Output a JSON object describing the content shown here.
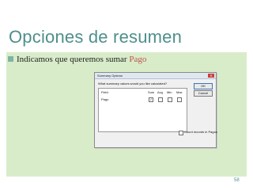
{
  "slide": {
    "title": "Opciones de resumen",
    "bullet_text": "Indicamos que queremos sumar ",
    "bullet_highlight": "Pago",
    "page_number": "58"
  },
  "dialog": {
    "title": "Summary Options",
    "close_glyph": "✕",
    "question": "What summary values would you like calculated?",
    "columns": {
      "field": "Field",
      "sum": "Sum",
      "avg": "Avg",
      "min": "Min",
      "max": "Max"
    },
    "rows": [
      {
        "name": "Pago",
        "sum_check": "✓",
        "avg_check": "",
        "min_check": "",
        "max_check": ""
      }
    ],
    "ok_label": "OK",
    "cancel_label": "Cancel",
    "count_label": "Count records in Pagos"
  },
  "colors": {
    "title": "#4e8f8c",
    "panel": "#d8ecc9",
    "highlight": "#c0504d"
  }
}
